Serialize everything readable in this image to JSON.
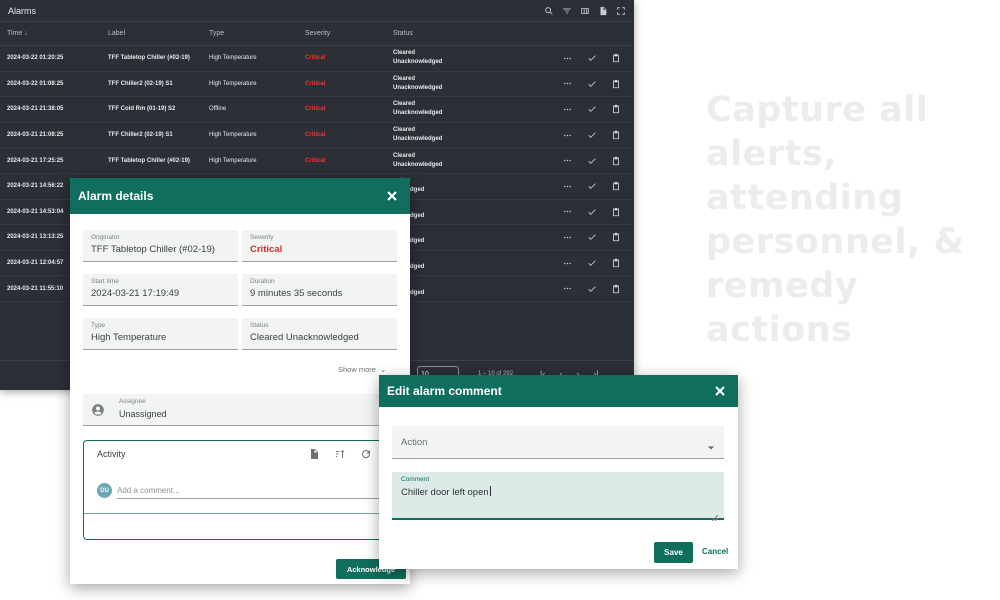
{
  "alarms": {
    "title": "Alarms",
    "columns": {
      "time": "Time ↓",
      "label": "Label",
      "type": "Type",
      "severity": "Severity",
      "status": "Status"
    },
    "rows": [
      {
        "time": "2024-03-22 01:20:25",
        "label": "TFF Tabletop Chiller (#02-19)",
        "type": "High Temperature",
        "severity": "Critical",
        "status1": "Cleared",
        "status2": "Unacknowledged"
      },
      {
        "time": "2024-03-22 01:08:25",
        "label": "TFF Chiller2 (02-19) S1",
        "type": "High Temperature",
        "severity": "Critical",
        "status1": "Cleared",
        "status2": "Unacknowledged"
      },
      {
        "time": "2024-03-21 21:38:05",
        "label": "TFF Cold Rm (01-19) S2",
        "type": "Offline",
        "severity": "Critical",
        "status1": "Cleared",
        "status2": "Unacknowledged"
      },
      {
        "time": "2024-03-21 21:08:25",
        "label": "TFF Chiller2 (02-19) S1",
        "type": "High Temperature",
        "severity": "Critical",
        "status1": "Cleared",
        "status2": "Unacknowledged"
      },
      {
        "time": "2024-03-21 17:25:25",
        "label": "TFF Tabletop Chiller (#02-19)",
        "type": "High Temperature",
        "severity": "Critical",
        "status1": "Cleared",
        "status2": "Unacknowledged"
      },
      {
        "time": "2024-03-21 14:56:22",
        "label": "",
        "type": "",
        "severity": "",
        "status1": "red",
        "status2": "nowledged"
      },
      {
        "time": "2024-03-21 14:53:04",
        "label": "",
        "type": "",
        "severity": "",
        "status1": "red",
        "status2": "nowledged"
      },
      {
        "time": "2024-03-21 13:13:25",
        "label": "",
        "type": "",
        "severity": "",
        "status1": "red",
        "status2": "nowledged"
      },
      {
        "time": "2024-03-21 12:04:57",
        "label": "",
        "type": "",
        "severity": "",
        "status1": "red",
        "status2": "nowledged"
      },
      {
        "time": "2024-03-21 11:55:10",
        "label": "",
        "type": "",
        "severity": "",
        "status1": "red",
        "status2": "nowledged"
      }
    ],
    "paginator": {
      "page_size": "10",
      "range": "1 – 10 of 292"
    }
  },
  "marketing": {
    "line1": "Capture all",
    "line2": "alerts, attending",
    "line3": "personnel, &",
    "line4": "remedy actions"
  },
  "details": {
    "title": "Alarm details",
    "originator_label": "Originator",
    "originator_value": "TFF Tabletop Chiller (#02-19)",
    "severity_label": "Severity",
    "severity_value": "Critical",
    "start_label": "Start time",
    "start_value": "2024-03-21 17:19:49",
    "duration_label": "Duration",
    "duration_value": "9 minutes 35 seconds",
    "type_label": "Type",
    "type_value": "High Temperature",
    "status_label": "Status",
    "status_value": "Cleared Unacknowledged",
    "show_more": "Show more",
    "assignee_label": "Assignee",
    "assignee_value": "Unassigned",
    "activity_title": "Activity",
    "avatar_initials": "DU",
    "comment_placeholder": "Add a comment...",
    "ack_label": "Acknowledge"
  },
  "edit": {
    "title": "Edit alarm comment",
    "action_placeholder": "Action",
    "comment_label": "Comment",
    "comment_value": "Chiller door left open",
    "save_label": "Save",
    "cancel_label": "Cancel"
  },
  "colors": {
    "primary": "#0f6e5e",
    "critical": "#d32f2f",
    "table_bg": "#2b2f36"
  }
}
